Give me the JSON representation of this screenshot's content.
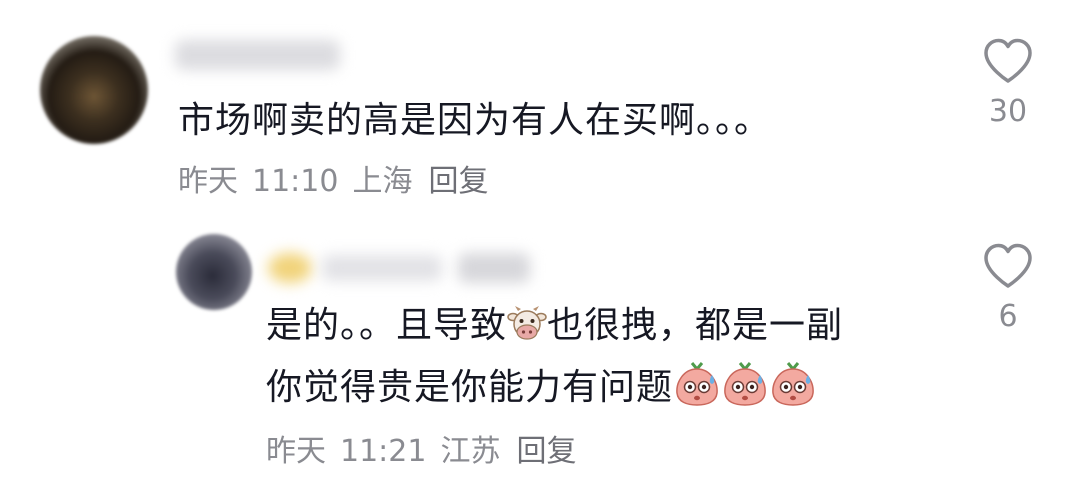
{
  "comments": [
    {
      "text": "市场啊卖的高是因为有人在买啊。。。",
      "date": "昨天",
      "time": "11:10",
      "location": "上海",
      "reply_label": "回复",
      "likes": "30"
    },
    {
      "text_line1_a": "是的。。且导致",
      "emoji_a": "cow-face",
      "text_line1_b": "也很拽，都是一副",
      "text_line2": "你觉得贵是你能力有问题",
      "emoji_b": "sweating-peach-face",
      "date": "昨天",
      "time": "11:21",
      "location": "江苏",
      "reply_label": "回复",
      "likes": "6"
    }
  ],
  "colors": {
    "text": "#161823",
    "meta": "#8a8b91",
    "icon": "#8a8b91"
  }
}
